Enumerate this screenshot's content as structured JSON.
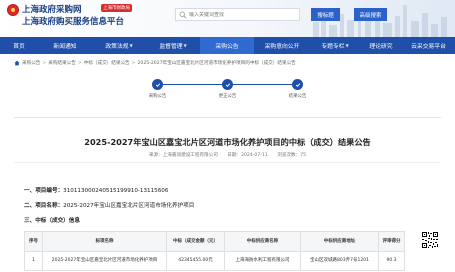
{
  "header": {
    "title_line1": "上海政府采购网",
    "tag": "上海市财政局",
    "title_line2": "上海政府购买服务信息平台",
    "search_placeholder": "输入关键词查找",
    "search_button": "搜标题",
    "advanced_button": "高级搜索"
  },
  "nav": {
    "items": [
      {
        "label": "首页",
        "dropdown": false
      },
      {
        "label": "新闻通知",
        "dropdown": false
      },
      {
        "label": "政策法规",
        "dropdown": true
      },
      {
        "label": "监督管理",
        "dropdown": true
      },
      {
        "label": "采购公告",
        "dropdown": false,
        "active": true
      },
      {
        "label": "采购意向公开",
        "dropdown": false
      },
      {
        "label": "专题专栏",
        "dropdown": true
      },
      {
        "label": "理论研究",
        "dropdown": false
      },
      {
        "label": "云采交易平台",
        "dropdown": false
      }
    ]
  },
  "breadcrumb": [
    "采购公告",
    "采购结果公告",
    "中标（成交）结果公告",
    "2025-2027年宝山区嘉宝北片区河道市场化养护项目的中标（成交）结果公告"
  ],
  "progress": {
    "steps": [
      "采购公告",
      "更正公告",
      "结果公告"
    ]
  },
  "document": {
    "title": "2025-2027年宝山区嘉宝北片区河道市场化养护项目的中标（成交）结果公告",
    "source": "来源：上海嘉润建设工程有限公司",
    "date": "日期：2024-07-11",
    "views": "浏览次数：75",
    "sec1_label": "一、项目编号：",
    "sec1_value": "310113000240515199910-13115606",
    "sec2_label": "二、项目名称：",
    "sec2_value": "2025-2027年宝山区嘉宝北片区河道市场化养护项目",
    "sec3_label": "三、中标（成交）信息"
  },
  "table": {
    "headers": [
      "序号",
      "标项名称",
      "中标（成交金额（元）",
      "中标供应商名称",
      "中标供应商地址",
      "评审得分"
    ],
    "rows": [
      [
        "1",
        "2025-2027年宝山区嘉宝北片区河道市场化养护项目",
        "42345455.00元",
        "上海海防水利工程有限公司",
        "宝山区双城路803弄7号1201",
        "90.3"
      ]
    ]
  },
  "colors": {
    "brand_blue": "#1f4fa8",
    "accent_blue": "#2a62c9",
    "tag_red": "#d32f2f"
  }
}
